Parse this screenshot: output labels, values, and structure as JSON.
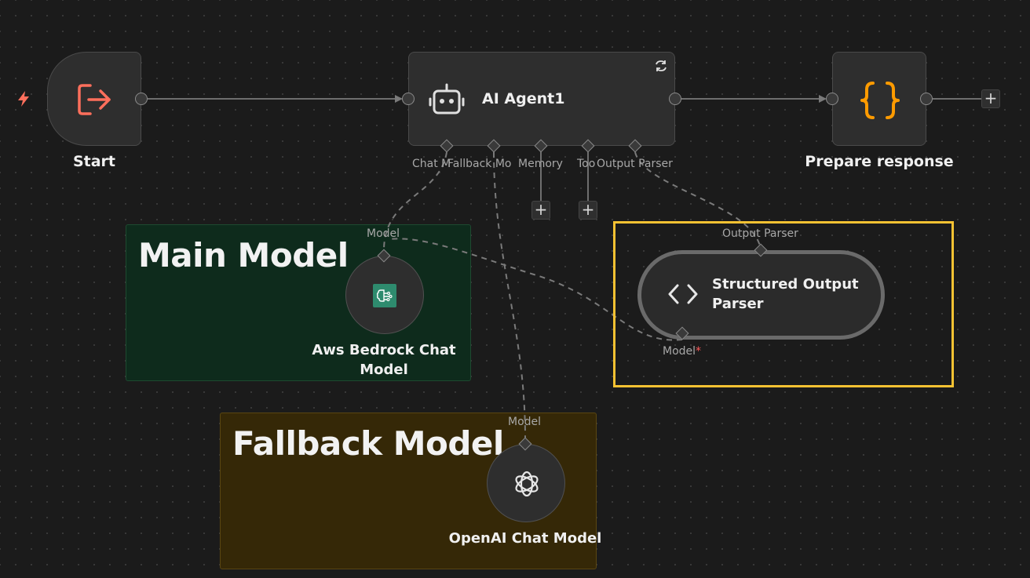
{
  "nodes": {
    "start": {
      "label": "Start",
      "icon": "sign-out-icon"
    },
    "agent": {
      "label": "AI Agent1",
      "icon": "robot-icon",
      "badge_icon": "refresh-icon"
    },
    "prepare": {
      "label": "Prepare response",
      "icon": "curly-braces-icon"
    },
    "bedrock": {
      "label_line1": "Aws Bedrock Chat",
      "label_line2": "Model",
      "icon": "brain-circuit-icon",
      "port_label": "Model"
    },
    "openai": {
      "label": "OpenAI Chat Model",
      "icon": "openai-icon",
      "port_label": "Model"
    },
    "parser": {
      "label_line1": "Structured Output",
      "label_line2": "Parser",
      "icon": "code-brackets-icon",
      "top_port_label": "Output Parser",
      "bottom_port_label": "Model",
      "required_marker": "*"
    }
  },
  "agent_ports": [
    {
      "label": "Chat M"
    },
    {
      "label": "Fallback Mo"
    },
    {
      "label": "Memory"
    },
    {
      "label": "Too"
    },
    {
      "label": "Output Parser"
    }
  ],
  "stickies": {
    "main": {
      "title": "Main Model"
    },
    "fallback": {
      "title": "Fallback Model"
    }
  },
  "buttons": {
    "plus": "+"
  },
  "colors": {
    "canvas_bg": "#1b1b1b",
    "trigger": "#ff6f5c",
    "braces": "#ff9b00",
    "selection": "#f7c232",
    "main_sticky": "#0e2b1c",
    "fallback_sticky": "#352807",
    "bedrock_icon_bg": "#2e8b6e"
  }
}
